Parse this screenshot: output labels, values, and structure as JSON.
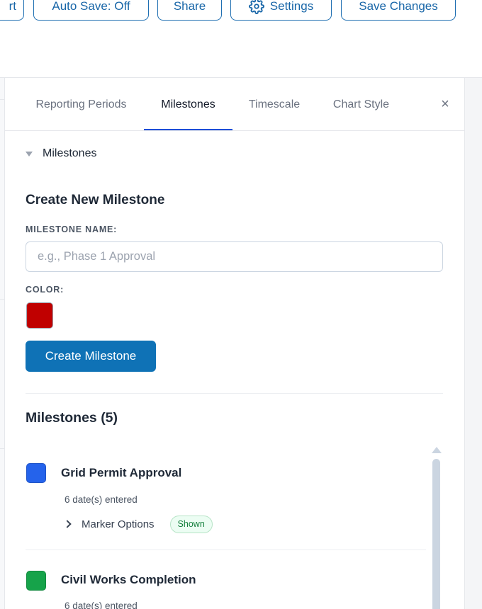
{
  "toolbar": {
    "buttons": [
      {
        "label": "rt"
      },
      {
        "label": "Auto Save: Off"
      },
      {
        "label": "Share"
      },
      {
        "label": "Settings",
        "icon": "gear-icon"
      },
      {
        "label": "Save Changes"
      }
    ]
  },
  "panel": {
    "tabs": [
      {
        "label": "Reporting Periods"
      },
      {
        "label": "Milestones",
        "active": true
      },
      {
        "label": "Timescale"
      },
      {
        "label": "Chart Style"
      }
    ],
    "close_icon": "×",
    "section_title": "Milestones",
    "create": {
      "heading": "Create New Milestone",
      "name_label": "MILESTONE NAME:",
      "name_placeholder": "e.g., Phase 1 Approval",
      "name_value": "",
      "color_label": "COLOR:",
      "color_value": "#c00000",
      "button_label": "Create Milestone"
    },
    "list": {
      "heading": "Milestones (5)",
      "items": [
        {
          "name": "Grid Permit Approval",
          "color": "#2563eb",
          "dates": "6 date(s) entered",
          "options_label": "Marker Options",
          "badge": "Shown"
        },
        {
          "name": "Civil Works Completion",
          "color": "#16a34a",
          "dates": "6 date(s) entered"
        }
      ]
    }
  },
  "colors": {
    "accent": "#0f72b6",
    "outline_button": "#1866a8",
    "active_tab_underline": "#1d4ed8"
  }
}
